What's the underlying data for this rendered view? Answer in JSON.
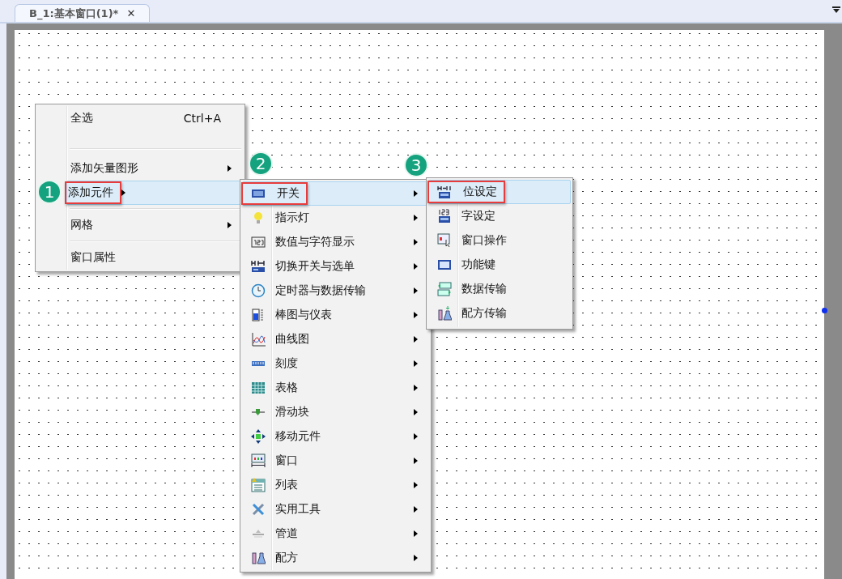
{
  "tab": {
    "title": "B_1:基本窗口(1)*",
    "close": "✕",
    "selected": true
  },
  "context_menu": {
    "items": [
      {
        "kind": "item",
        "label": "全选",
        "shortcut": "Ctrl+A",
        "submenu": false,
        "selected": false,
        "marked": false
      },
      {
        "kind": "separator"
      },
      {
        "kind": "item",
        "label": "添加矢量图形",
        "submenu": true,
        "selected": false,
        "marked": false
      },
      {
        "kind": "item",
        "label": "添加元件",
        "submenu": true,
        "selected": true,
        "marked": true,
        "badge": "1"
      },
      {
        "kind": "separator"
      },
      {
        "kind": "item",
        "label": "网格",
        "submenu": true,
        "selected": false,
        "marked": false
      },
      {
        "kind": "separator"
      },
      {
        "kind": "item",
        "label": "窗口属性",
        "submenu": false,
        "selected": false,
        "marked": false
      }
    ]
  },
  "component_menu": {
    "items": [
      {
        "label": "开关",
        "submenu": true,
        "selected": true,
        "marked": true,
        "badge": "2"
      },
      {
        "label": "指示灯",
        "submenu": true,
        "selected": false,
        "marked": false
      },
      {
        "label": "数值与字符显示",
        "submenu": true,
        "selected": false,
        "marked": false
      },
      {
        "label": "切换开关与选单",
        "submenu": true,
        "selected": false,
        "marked": false
      },
      {
        "label": "定时器与数据传输",
        "submenu": true,
        "selected": false,
        "marked": false
      },
      {
        "label": "棒图与仪表",
        "submenu": true,
        "selected": false,
        "marked": false
      },
      {
        "label": "曲线图",
        "submenu": true,
        "selected": false,
        "marked": false
      },
      {
        "label": "刻度",
        "submenu": true,
        "selected": false,
        "marked": false
      },
      {
        "label": "表格",
        "submenu": true,
        "selected": false,
        "marked": false
      },
      {
        "label": "滑动块",
        "submenu": true,
        "selected": false,
        "marked": false
      },
      {
        "label": "移动元件",
        "submenu": true,
        "selected": false,
        "marked": false
      },
      {
        "label": "窗口",
        "submenu": true,
        "selected": false,
        "marked": false
      },
      {
        "label": "列表",
        "submenu": true,
        "selected": false,
        "marked": false
      },
      {
        "label": "实用工具",
        "submenu": true,
        "selected": false,
        "marked": false
      },
      {
        "label": "管道",
        "submenu": true,
        "selected": false,
        "marked": false
      },
      {
        "label": "配方",
        "submenu": true,
        "selected": false,
        "marked": false
      }
    ]
  },
  "switch_menu": {
    "items": [
      {
        "label": "位设定",
        "selected": true,
        "marked": true,
        "badge": "3"
      },
      {
        "label": "字设定",
        "selected": false,
        "marked": false
      },
      {
        "label": "窗口操作",
        "selected": false,
        "marked": false
      },
      {
        "label": "功能键",
        "selected": false,
        "marked": false
      },
      {
        "label": "数据传输",
        "selected": false,
        "marked": false
      },
      {
        "label": "配方传输",
        "selected": false,
        "marked": false
      }
    ]
  }
}
